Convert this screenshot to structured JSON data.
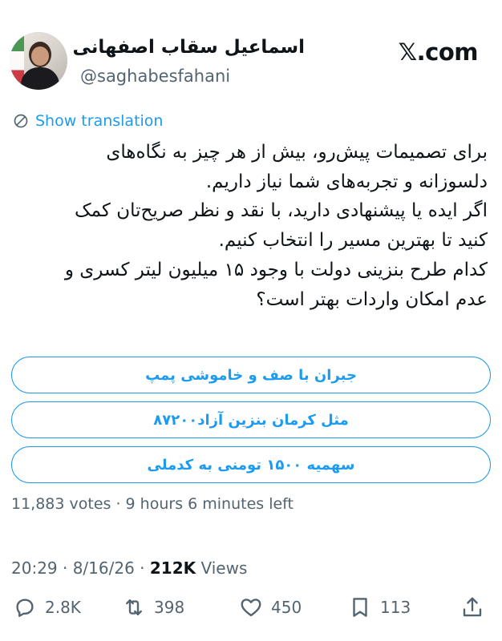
{
  "author": {
    "display_name": "اسماعیل سقاب اصفهانی",
    "handle": "@saghabesfahani"
  },
  "brand": {
    "logo_text": "𝕏.com"
  },
  "translate": {
    "label": "Show translation"
  },
  "tweet": {
    "lines": [
      "برای تصمیمات پیش‌رو، بیش از هر چیز به نگاه‌های",
      "دلسوزانه و تجربه‌های شما نیاز داریم.",
      "اگر ایده یا پیشنهادی دارید، با نقد و نظر صریح‌تان کمک",
      "کنید تا بهترین مسیر را انتخاب کنیم.",
      "کدام طرح بنزینی دولت با وجود ۱۵ میلیون لیتر کسری و",
      "عدم امکان واردات بهتر است؟"
    ]
  },
  "poll": {
    "options": [
      "جبران با صف و خاموشی پمپ",
      "مثل کرمان بنزین آزاد۸۷۲۰۰",
      "سهمیه ۱۵۰۰ تومنی به کدملی"
    ],
    "meta": "11,883 votes · 9 hours 6 minutes left"
  },
  "timestamp": {
    "time_date": "20:29 · 8/16/26 · ",
    "views_count": "212K",
    "views_label": " Views"
  },
  "actions": {
    "replies": "2.8K",
    "reposts": "398",
    "likes": "450",
    "bookmarks": "113"
  },
  "colors": {
    "accent": "#1d9bf0",
    "muted": "#536471",
    "text": "#0f1419"
  }
}
